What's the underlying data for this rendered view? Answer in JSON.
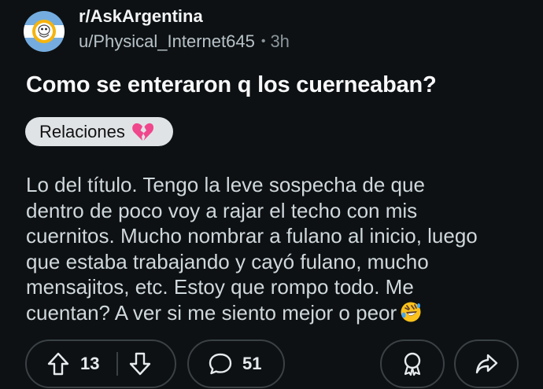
{
  "header": {
    "subreddit": "r/AskArgentina",
    "author": "u/Physical_Internet645",
    "separator": "•",
    "time": "3h",
    "avatar_icon": "subreddit-avatar-icon"
  },
  "post": {
    "title": "Como se enteraron q los cuerneaban?",
    "flair": {
      "label": "Relaciones",
      "icon": "broken-heart-icon"
    },
    "body_lines": [
      "Lo del título. Tengo la leve sospecha de que",
      "dentro de poco voy a rajar el techo con mis",
      "cuernitos. Mucho nombrar a fulano al inicio, luego",
      "que estaba trabajando y cayó fulano, mucho",
      "mensajitos, etc. Estoy que rompo todo. Me",
      "cuentan? A ver si me siento mejor o peor"
    ],
    "body_emoji": "rolling-on-floor-laughing-icon"
  },
  "actions": {
    "upvotes": "13",
    "comments": "51",
    "upvote_icon": "upvote-arrow-icon",
    "downvote_icon": "downvote-arrow-icon",
    "comment_icon": "comment-bubble-icon",
    "award_icon": "award-icon",
    "share_icon": "share-icon"
  },
  "colors": {
    "background": "#0e1113",
    "flair_bg": "#dfe3e6",
    "pill_border": "#3a4145",
    "flag_blue": "#74acdf"
  }
}
